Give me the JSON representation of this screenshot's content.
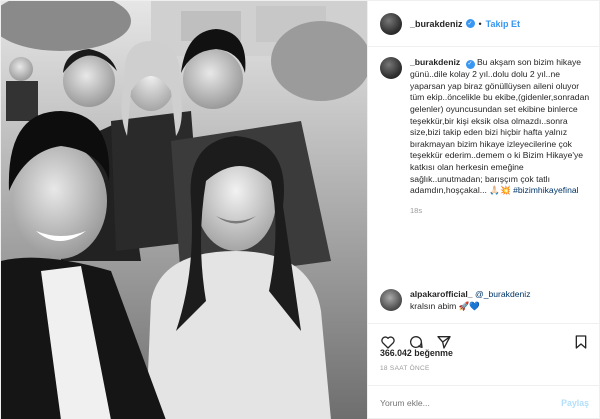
{
  "photo": {
    "description_icon": "group-selfie-photo"
  },
  "header": {
    "username": "_burakdeniz",
    "verified_icon": "verified-badge-icon",
    "separator": "•",
    "follow_label": "Takip Et"
  },
  "caption": {
    "username": "_burakdeniz",
    "text": "Bu akşam son bizim hikaye günü..dile kolay 2 yıl..dolu dolu 2 yıl..ne yaparsan yap biraz gönüllüysen aileni oluyor tüm ekip..öncelikle bu ekibe,(gidenler,sonradan gelenler) oyuncusundan set ekibine binlerce teşekkür,bir kişi eksik olsa olmazdı..sonra size,bizi takip eden bizi hiçbir hafta yalnız bırakmayan bizim hikaye izleyecilerine çok teşekkür ederim..demem o ki Bizim Hikaye'ye katkısı olan herkesin emeğine sağlık..unutmadan; barışçım çok tatlı adamdın,hoşçakal... 🙏🏻💥",
    "hashtag": "#bizimhikayefinal",
    "time": "18s"
  },
  "comment": {
    "username": "alpakarofficial_",
    "mention": "@_burakdeniz",
    "text": "kralsın abim 🚀💙"
  },
  "actions": {
    "like_icon": "heart-icon",
    "comment_icon": "comment-icon",
    "share_icon": "share-icon",
    "save_icon": "bookmark-icon"
  },
  "likes": {
    "count": "366.042",
    "label": "beğenme"
  },
  "timestamp": "18 SAAT ÖNCE",
  "comment_input": {
    "placeholder": "Yorum ekle...",
    "post_label": "Paylaş"
  },
  "colors": {
    "link": "#3897f0",
    "hashtag": "#003569",
    "muted": "#999999",
    "post_disabled": "#b2dffc"
  }
}
